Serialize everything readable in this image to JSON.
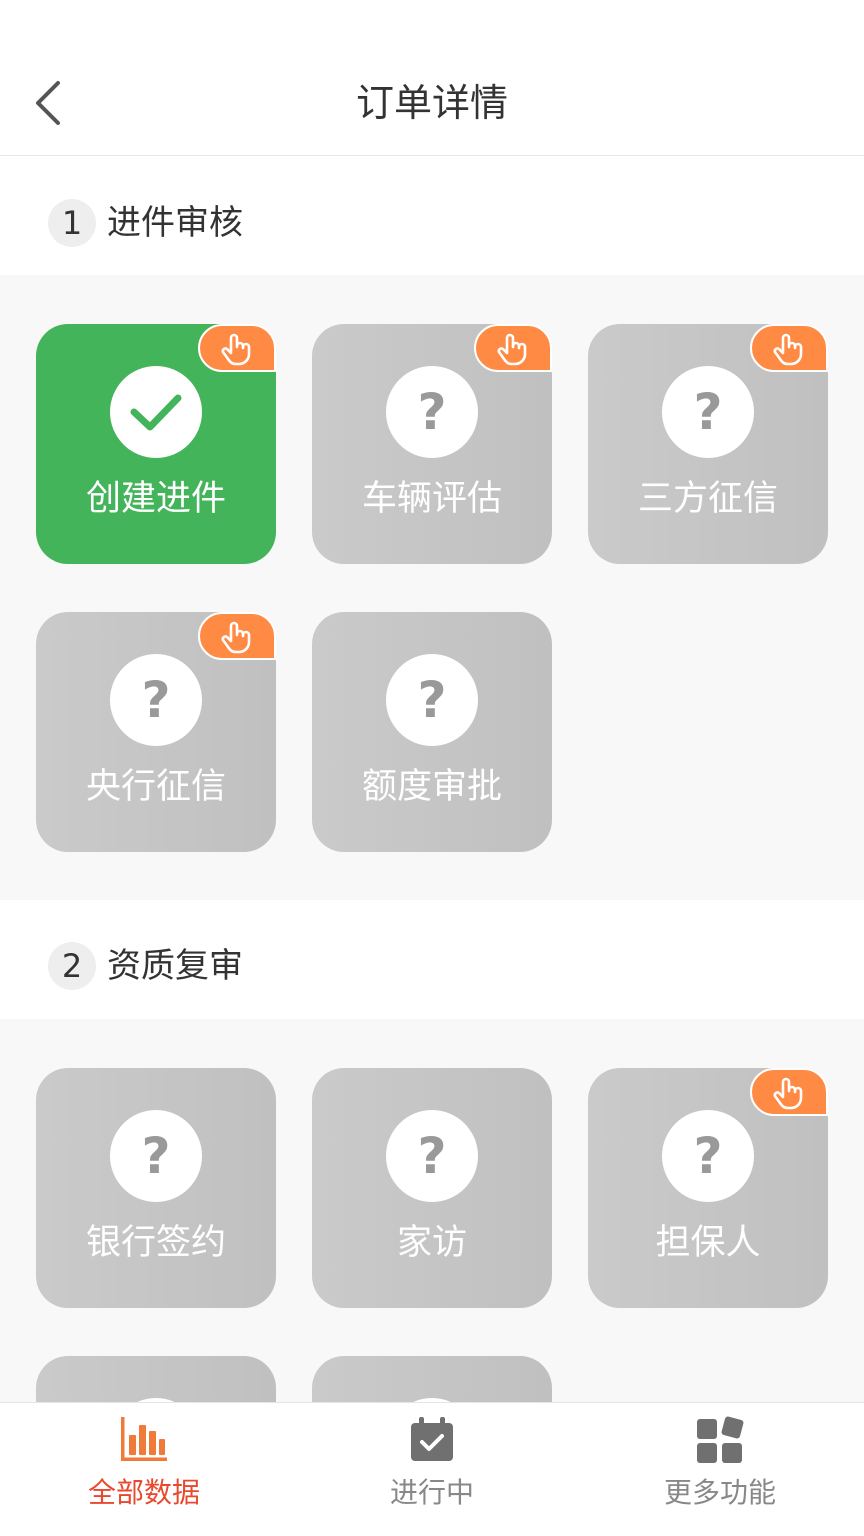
{
  "header": {
    "title": "订单详情"
  },
  "colors": {
    "done": "#43b45a",
    "pending": "#c4c4c4",
    "badge": "#ff8a44",
    "active_tab": "#e8492e"
  },
  "sections": [
    {
      "number": "1",
      "title": "进件审核",
      "tiles": [
        {
          "label": "创建进件",
          "status": "done",
          "icon": "check-icon",
          "badge": true
        },
        {
          "label": "车辆评估",
          "status": "pending",
          "icon": "question-icon",
          "badge": true,
          "mark": "?"
        },
        {
          "label": "三方征信",
          "status": "pending",
          "icon": "question-icon",
          "badge": true,
          "mark": "?"
        },
        {
          "label": "央行征信",
          "status": "pending",
          "icon": "question-icon",
          "badge": true,
          "mark": "?"
        },
        {
          "label": "额度审批",
          "status": "pending",
          "icon": "question-icon",
          "badge": false,
          "mark": "?"
        }
      ]
    },
    {
      "number": "2",
      "title": "资质复审",
      "tiles": [
        {
          "label": "银行签约",
          "status": "pending",
          "icon": "question-icon",
          "badge": false,
          "mark": "?"
        },
        {
          "label": "家访",
          "status": "pending",
          "icon": "question-icon",
          "badge": false,
          "mark": "?"
        },
        {
          "label": "担保人",
          "status": "pending",
          "icon": "question-icon",
          "badge": true,
          "mark": "?"
        }
      ]
    }
  ],
  "tabbar": {
    "items": [
      {
        "label": "全部数据",
        "icon": "bar-chart-icon",
        "active": true
      },
      {
        "label": "进行中",
        "icon": "calendar-check-icon",
        "active": false
      },
      {
        "label": "更多功能",
        "icon": "grid-icon",
        "active": false
      }
    ]
  }
}
